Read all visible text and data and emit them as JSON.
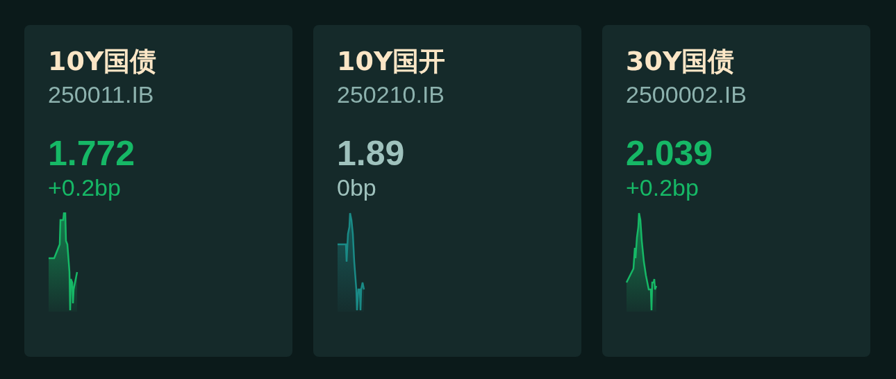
{
  "cards": [
    {
      "name": "10Y国债",
      "code": "250011.IB",
      "yield": "1.772",
      "change": "+0.2bp",
      "color": "#16b866"
    },
    {
      "name": "10Y国开",
      "code": "250210.IB",
      "yield": "1.89",
      "change": "0bp",
      "color": "#9fc2bd"
    },
    {
      "name": "30Y国债",
      "code": "2500002.IB",
      "yield": "2.039",
      "change": "+0.2bp",
      "color": "#16b866"
    }
  ]
}
